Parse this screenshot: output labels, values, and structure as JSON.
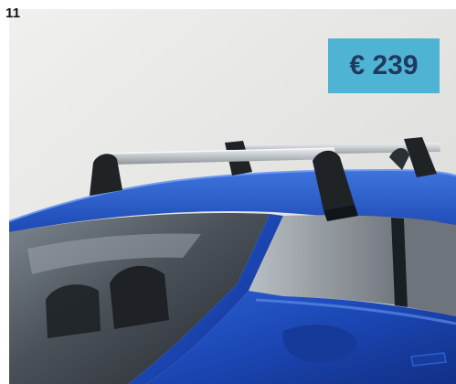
{
  "item": {
    "number": "11"
  },
  "price": {
    "label": "€ 239"
  },
  "product_image": {
    "subject": "roof-bars-on-blue-car-icon"
  },
  "colors": {
    "badge_background": "#4fb4d3",
    "price_text": "#20395f",
    "car_body": "#1f4dbf",
    "roof_bar_silver": "#c8cbcd",
    "bar_foot_black": "#1f2326",
    "backdrop": "#e7e7e5"
  }
}
